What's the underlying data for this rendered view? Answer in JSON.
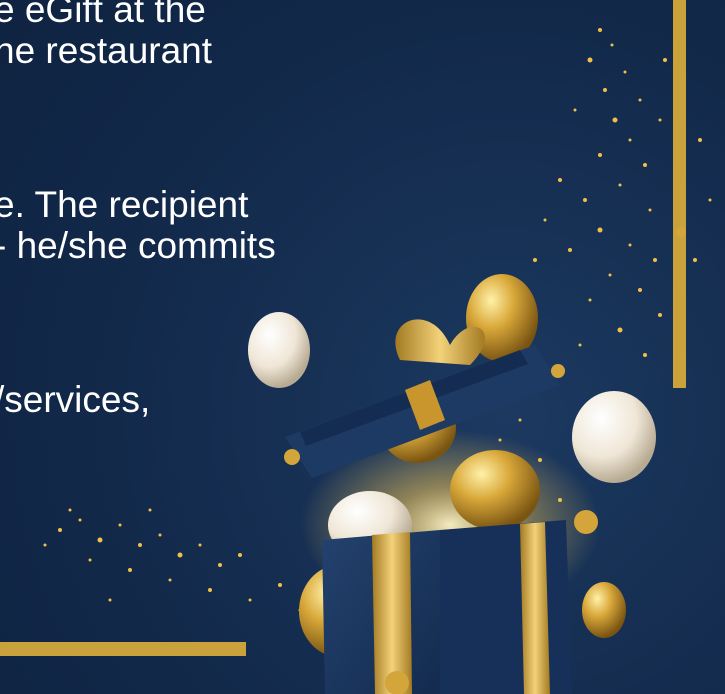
{
  "text_lines": [
    "e eGift at the",
    "ne restaurant",
    "e. The recipient",
    "- he/she commits",
    "/services,"
  ],
  "colors": {
    "background": "#12294a",
    "gold": "#d4a53a",
    "gold_frame": "#c9a23c",
    "box_navy": "#1a3560",
    "text": "#ffffff"
  },
  "icons": [
    "gift-box-icon",
    "balloon-icon",
    "sparkle-icon"
  ]
}
